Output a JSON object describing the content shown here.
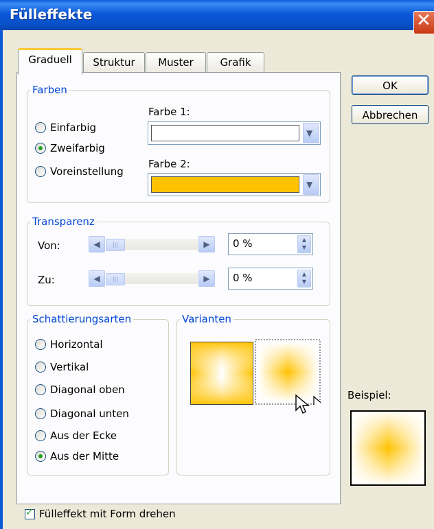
{
  "window": {
    "title": "Fülleffekte",
    "close_glyph": "✕"
  },
  "tabs": [
    "Graduell",
    "Struktur",
    "Muster",
    "Grafik"
  ],
  "farben": {
    "legend": "Farben",
    "options": [
      "Einfarbig",
      "Zweifarbig",
      "Voreinstellung"
    ],
    "selected": "Zweifarbig",
    "color1_label": "Farbe 1:",
    "color1_value": "#ffffff",
    "color2_label": "Farbe 2:",
    "color2_value": "#ffc200"
  },
  "transparenz": {
    "legend": "Transparenz",
    "von_label": "Von:",
    "von_value": "0 %",
    "zu_label": "Zu:",
    "zu_value": "0 %"
  },
  "schattierung": {
    "legend": "Schattierungsarten",
    "options": [
      "Horizontal",
      "Vertikal",
      "Diagonal oben",
      "Diagonal unten",
      "Aus der Ecke",
      "Aus der Mitte"
    ],
    "selected": "Aus der Mitte"
  },
  "varianten": {
    "legend": "Varianten",
    "selected_index": 1
  },
  "buttons": {
    "ok": "OK",
    "cancel": "Abbrechen"
  },
  "beispiel_label": "Beispiel:",
  "checkbox": {
    "label": "Fülleffekt mit Form drehen",
    "checked": true
  }
}
